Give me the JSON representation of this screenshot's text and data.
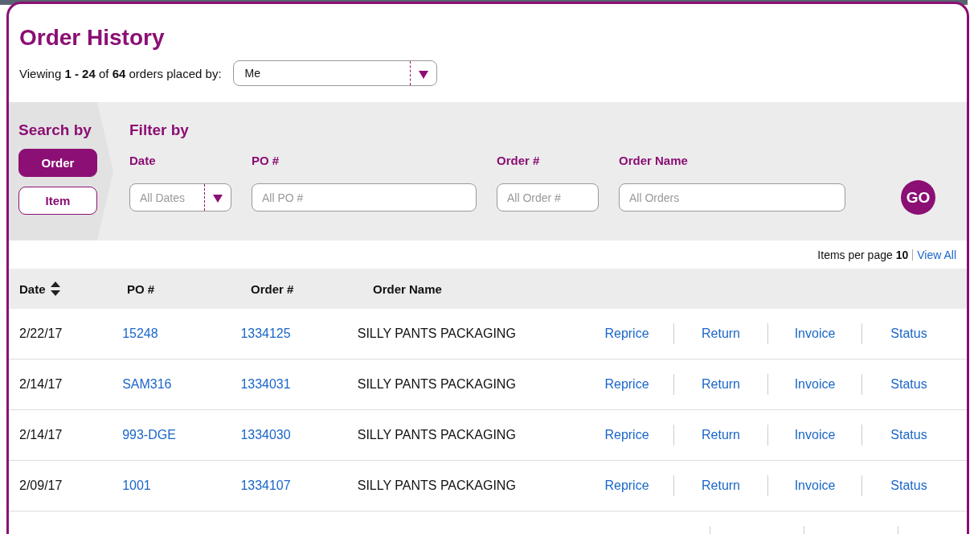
{
  "title": "Order History",
  "viewing": {
    "text": "Viewing **1 - 24** of **64** orders placed by:",
    "placed_by": "Me"
  },
  "search_by": {
    "heading": "Search by",
    "options": [
      {
        "label": "Order",
        "selected": true
      },
      {
        "label": "Item",
        "selected": false
      }
    ]
  },
  "filter_by": {
    "heading": "Filter by",
    "fields": [
      {
        "label": "Date",
        "placeholder": "All Dates",
        "kind": "dropdown"
      },
      {
        "label": "PO #",
        "placeholder": "All PO #",
        "kind": "text"
      },
      {
        "label": "Order #",
        "placeholder": "All Order #",
        "kind": "text"
      },
      {
        "label": "Order Name",
        "placeholder": "All Orders",
        "kind": "text"
      }
    ],
    "go": "GO"
  },
  "paging": {
    "label": "Items per page",
    "count": "10",
    "view_all": "View All"
  },
  "table": {
    "columns": [
      "Date",
      "PO #",
      "Order #",
      "Order Name"
    ],
    "rows": [
      {
        "date": "2/22/17",
        "po": "15248",
        "order": "1334125",
        "name": "SILLY PANTS PACKAGING",
        "actions": [
          "Reprice",
          "Return",
          "Invoice",
          "Status"
        ]
      },
      {
        "date": "2/14/17",
        "po": "SAM316",
        "order": "1334031",
        "name": "SILLY PANTS PACKAGING",
        "actions": [
          "Reprice",
          "Return",
          "Invoice",
          "Status"
        ]
      },
      {
        "date": "2/14/17",
        "po": "993-DGE",
        "order": "1334030",
        "name": "SILLY PANTS PACKAGING",
        "actions": [
          "Reprice",
          "Return",
          "Invoice",
          "Status"
        ]
      },
      {
        "date": "2/09/17",
        "po": "1001",
        "order": "1334107",
        "name": "SILLY PANTS PACKAGING",
        "actions": [
          "Reprice",
          "Return",
          "Invoice",
          "Status"
        ]
      }
    ]
  }
}
